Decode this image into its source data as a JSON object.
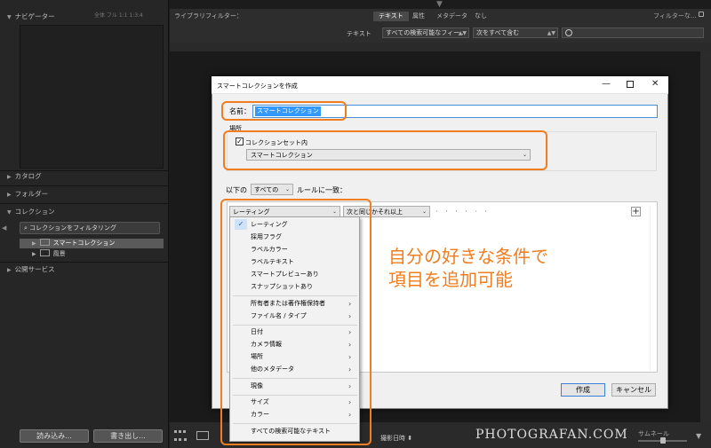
{
  "navigator": {
    "title": "ナビゲーター",
    "zoom_options": "全体 フル 1:1 1:3:4"
  },
  "left_panels": {
    "catalog": "カタログ",
    "folders": "フォルダー",
    "collections": "コレクション",
    "collection_filter": "コレクションをフィルタリング",
    "tree": [
      {
        "label": "スマートコレクション",
        "selected": true
      },
      {
        "label": "風景",
        "selected": false
      }
    ],
    "publish_services": "公開サービス",
    "import_button": "読み込み...",
    "export_button": "書き出し..."
  },
  "filter_bar": {
    "title": "ライブラリフィルター：",
    "tabs": [
      "テキスト",
      "属性",
      "メタデータ",
      "なし"
    ],
    "active_tab": "テキスト",
    "filter_off": "フィルターな...",
    "text_label": "テキスト",
    "field_select": "すべての検索可能なフィー...",
    "rule_select": "次をすべて含む",
    "search_placeholder": ""
  },
  "bottom_bar": {
    "sort_label": "撮影日時",
    "thumbnail_label": "サムネール",
    "watermark": "PHOTOGRAFAN.COM"
  },
  "dialog": {
    "title": "スマートコレクションを作成",
    "controls": {
      "minimize": "—",
      "close": "✕"
    },
    "name_label": "名前：",
    "name_value": "スマートコレクション",
    "place_label": "場所",
    "inside_set_label": "コレクションセット内",
    "inside_set_checked": true,
    "set_select": "スマートコレクション",
    "rule_prefix": "以下の",
    "match_select": "すべての",
    "rule_suffix": "ルールに一致：",
    "rule_field": "レーティング",
    "rule_operator": "次と同じかそれ以上",
    "rule_value_dots": "· · · · · ·",
    "add_rule": "+",
    "create_button": "作成",
    "cancel_button": "キャンセル"
  },
  "dropdown": {
    "items": [
      {
        "label": "レーティング",
        "checked": true,
        "submenu": false
      },
      {
        "label": "採用フラグ",
        "submenu": false
      },
      {
        "label": "ラベルカラー",
        "submenu": false
      },
      {
        "label": "ラベルテキスト",
        "submenu": false
      },
      {
        "label": "スマートプレビューあり",
        "submenu": false
      },
      {
        "label": "スナップショットあり",
        "submenu": false
      },
      {
        "label": "所有者または著作権保持者",
        "submenu": true
      },
      {
        "label": "ファイル名 / タイプ",
        "submenu": true
      },
      {
        "label": "日付",
        "submenu": true
      },
      {
        "label": "カメラ情報",
        "submenu": true
      },
      {
        "label": "場所",
        "submenu": true
      },
      {
        "label": "他のメタデータ",
        "submenu": true
      },
      {
        "label": "現像",
        "submenu": true
      },
      {
        "label": "サイズ",
        "submenu": true
      },
      {
        "label": "カラー",
        "submenu": true
      },
      {
        "label": "すべての検索可能なテキスト",
        "submenu": false
      }
    ],
    "submenu_arrow": "›",
    "check_mark": "✓"
  },
  "annotation": {
    "line1": "自分の好きな条件で",
    "line2": "項目を追加可能",
    "color": "#f07d1e"
  },
  "colors": {
    "accent_orange": "#f07d1e",
    "selection_blue": "#3399ff",
    "lr_panel": "#262626"
  }
}
